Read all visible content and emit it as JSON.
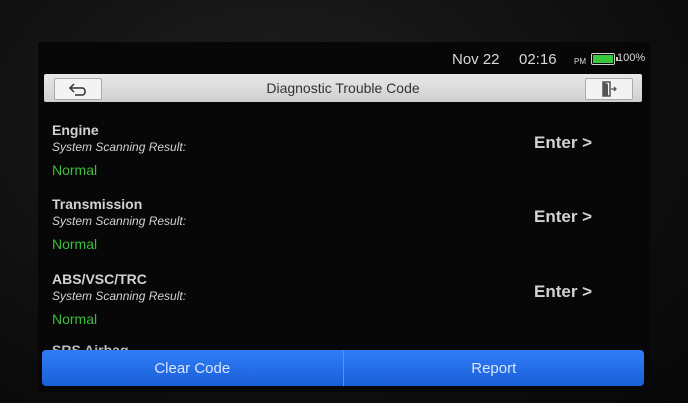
{
  "statusbar": {
    "date": "Nov 22",
    "time": "02:16",
    "ampm": "PM",
    "battery_percent": "100%",
    "battery_level": 1.0,
    "battery_color": "#37c93a"
  },
  "titlebar": {
    "title": "Diagnostic Trouble Code",
    "back_icon": "back-arrow-icon",
    "exit_icon": "exit-door-icon"
  },
  "systems": [
    {
      "name": "Engine",
      "label": "System Scanning Result:",
      "status": "Normal",
      "action": "Enter >"
    },
    {
      "name": "Transmission",
      "label": "System Scanning Result:",
      "status": "Normal",
      "action": "Enter >"
    },
    {
      "name": "ABS/VSC/TRC",
      "label": "System Scanning Result:",
      "status": "Normal",
      "action": "Enter >"
    }
  ],
  "partial_item": "SRS Airbag",
  "buttons": {
    "clear_code": "Clear Code",
    "report": "Report"
  },
  "colors": {
    "normal_status": "#3bbf3b",
    "button_blue": "#2f7ef7"
  }
}
